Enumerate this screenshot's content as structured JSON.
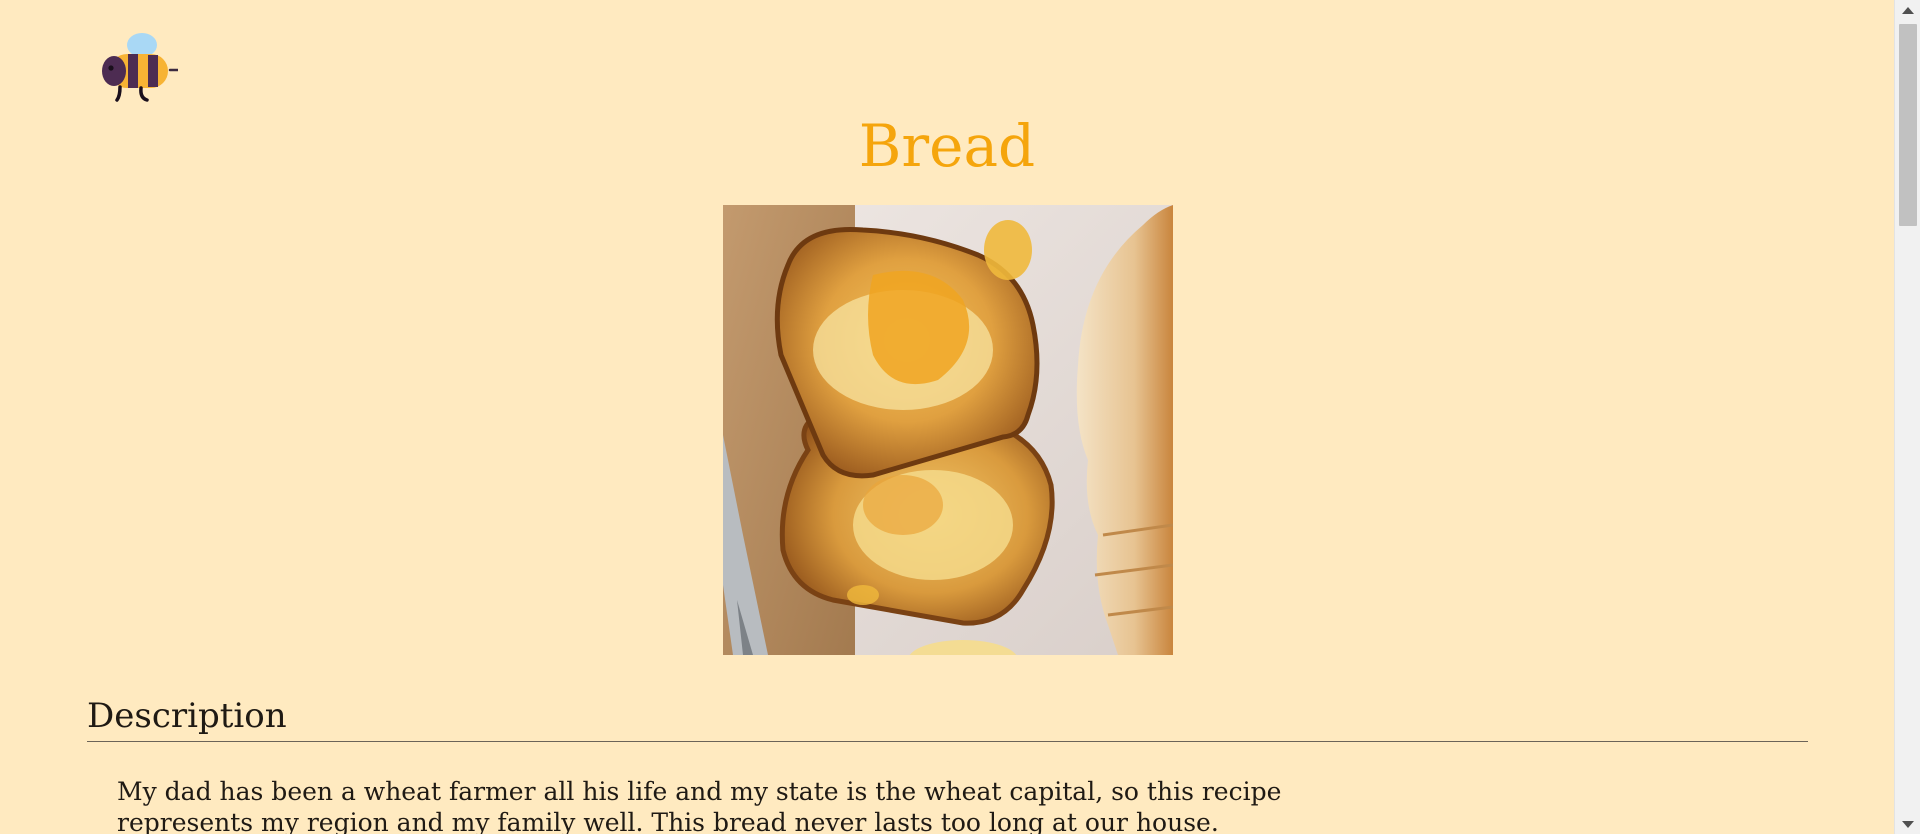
{
  "logo": {
    "icon": "bee-icon"
  },
  "recipe": {
    "title": "Bread",
    "image": {
      "icon": "bread-toast-photo",
      "description_colors": {
        "toast": "#c9862d",
        "butter": "#f6dd8c",
        "board": "#b58a5c",
        "counter": "#e8e1dc",
        "loaf": "#e2b173"
      }
    },
    "description_heading": "Description",
    "description_text": "My dad has been a wheat farmer all his life and my state is the wheat capital, so this recipe represents my region and my family well. This bread never lasts too long at our house."
  },
  "colors": {
    "background": "#ffeac0",
    "title": "#f5a50c",
    "text": "#1f1a14"
  }
}
